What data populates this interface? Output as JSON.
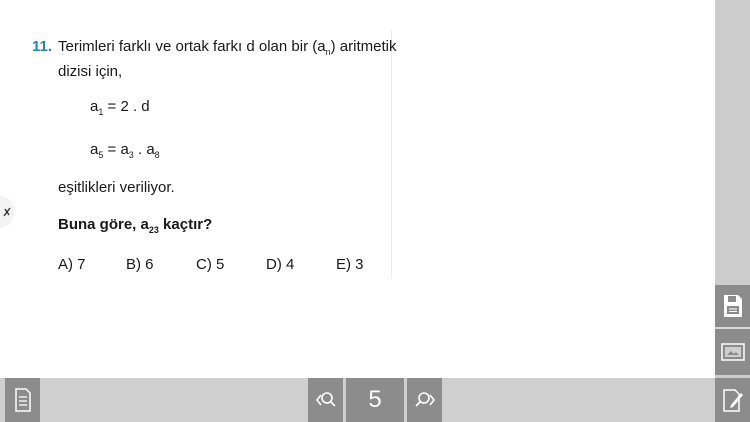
{
  "question": {
    "number": "11.",
    "line1": "Terimleri farklı ve ortak farkı d olan bir (a",
    "line1_sub": "n",
    "line1_end": ") aritmetik",
    "line2": "dizisi için,",
    "eq1": {
      "a": "a",
      "sub": "1",
      "rest": " = 2 . d"
    },
    "eq2": {
      "a1": "a",
      "s1": "5",
      "mid1": " = a",
      "s2": "3",
      "mid2": " . a",
      "s3": "8"
    },
    "given": "eşitlikleri veriliyor.",
    "ask_pre": "Buna göre, a",
    "ask_sub": "23",
    "ask_post": " kaçtır?",
    "choices": [
      "A) 7",
      "B) 6",
      "C) 5",
      "D) 4",
      "E) 3"
    ]
  },
  "toolbar": {
    "page_number": "5",
    "icons": {
      "left": "document-icon",
      "prev": "prev-search-icon",
      "next": "next-search-icon",
      "save": "save-icon",
      "image": "image-icon",
      "edit": "edit-note-icon"
    }
  },
  "colors": {
    "accent": "#1e86c6",
    "toolbar_button": "#8c8c8c",
    "toolbar_background": "#cfcfcf"
  }
}
